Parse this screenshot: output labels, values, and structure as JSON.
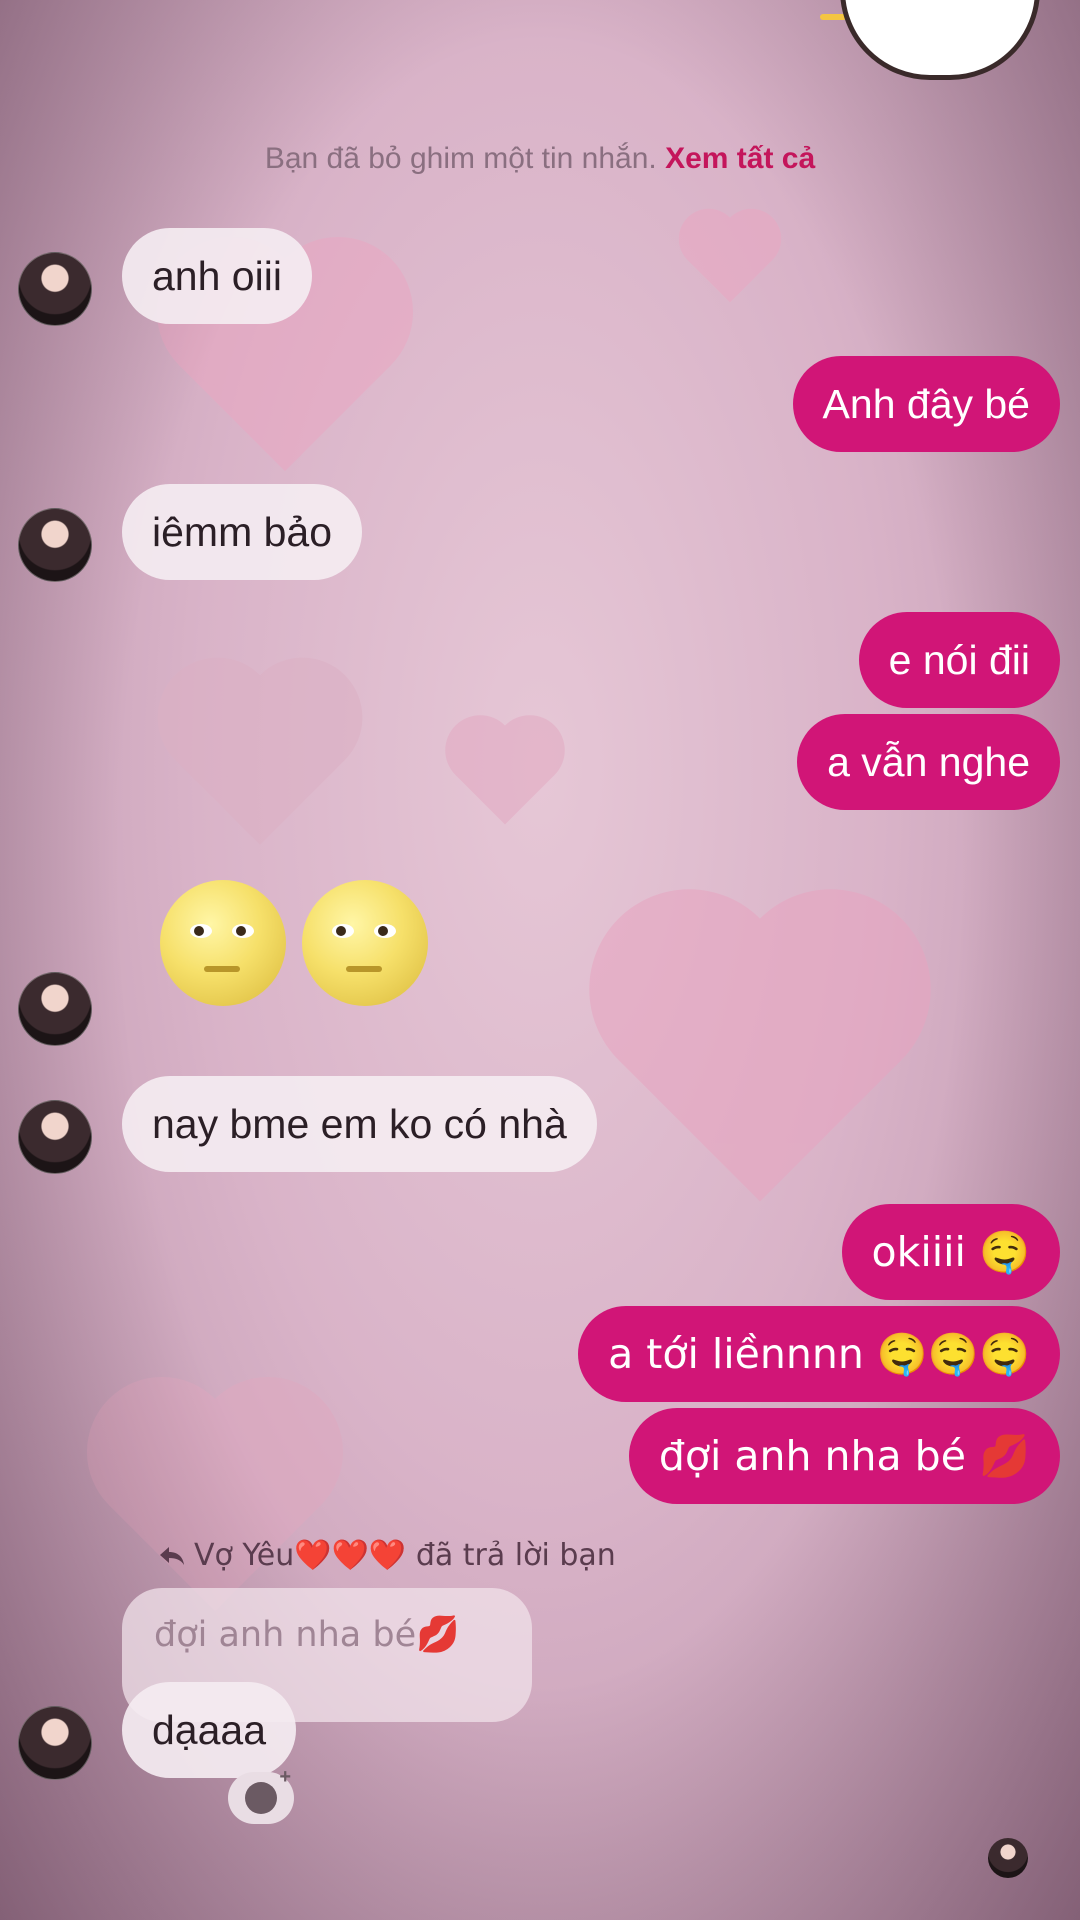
{
  "pin_note": {
    "text": "Bạn đã bỏ ghim một tin nhắn.",
    "link": "Xem tất cả"
  },
  "messages": [
    {
      "dir": "in",
      "text": "anh oiii"
    },
    {
      "dir": "out",
      "text": "Anh đây bé"
    },
    {
      "dir": "in",
      "text": "iêmm bảo"
    },
    {
      "dir": "out",
      "text": "e nói đii"
    },
    {
      "dir": "out",
      "text": "a vẫn nghe"
    },
    {
      "dir": "in",
      "text": "🌝🌝"
    },
    {
      "dir": "in",
      "text": "nay bme em ko có nhà"
    },
    {
      "dir": "out",
      "text": "okiiii 🤤"
    },
    {
      "dir": "out",
      "text": "a tới liềnnnn 🤤🤤🤤"
    },
    {
      "dir": "out",
      "text": "đợi anh nha bé 💋"
    },
    {
      "dir": "in",
      "text": "dạaaa"
    }
  ],
  "reply": {
    "label": "Vợ Yêu❤️❤️❤️ đã trả lời bạn",
    "quoted": "đợi anh nha bé💋"
  },
  "colors": {
    "outgoing": "#d11577",
    "incoming": "#f4ecf1",
    "link": "#c4155b"
  },
  "icons": {
    "reply": "reply-arrow-icon",
    "react": "add-reaction-icon",
    "seen": "seen-avatar-icon"
  }
}
